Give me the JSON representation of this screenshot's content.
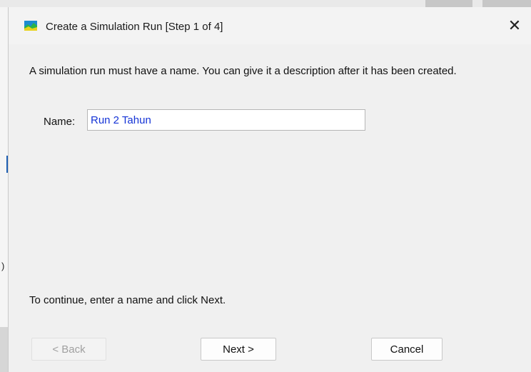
{
  "window": {
    "title": "Create a Simulation Run [Step 1 of 4]",
    "app_icon": "simulation-run-icon",
    "close_glyph": "✕"
  },
  "content": {
    "intro": "A simulation run must have a name. You can give it a description after it has been created.",
    "name_label": "Name:",
    "name_value": "Run 2 Tahun",
    "hint": "To continue, enter a name and click Next."
  },
  "buttons": {
    "back": "< Back",
    "next": "Next >",
    "cancel": "Cancel"
  },
  "background": {
    "paren": ")"
  },
  "colors": {
    "dialog_bg": "#f0f0f0",
    "input_text": "#1433d6",
    "disabled_text": "#a0a0a0"
  }
}
